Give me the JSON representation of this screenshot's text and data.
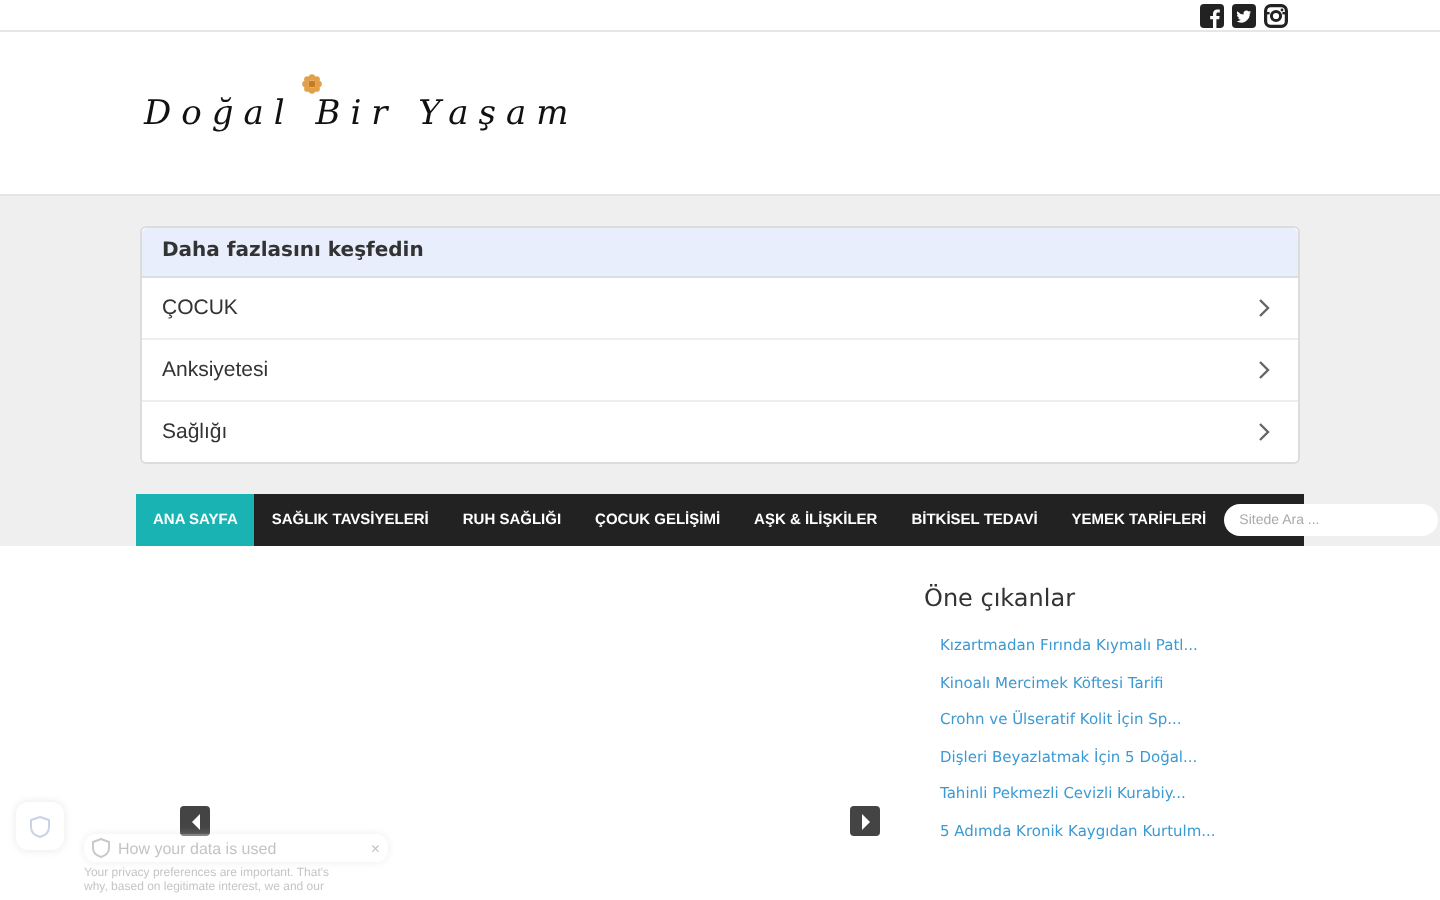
{
  "site": {
    "logo": "Doğal Bir Yaşam"
  },
  "explore": {
    "title": "Daha fazlasını keşfedin",
    "items": [
      "ÇOCUK",
      "Anksiyetesi",
      "Sağlığı"
    ]
  },
  "nav": {
    "items": [
      {
        "label": "ANA SAYFA",
        "selected": true
      },
      {
        "label": "SAĞLIK TAVSİYELERİ",
        "selected": false
      },
      {
        "label": "RUH SAĞLIĞI",
        "selected": false
      },
      {
        "label": "ÇOCUK GELİŞİMİ",
        "selected": false
      },
      {
        "label": "AŞK & İLİŞKİLER",
        "selected": false
      },
      {
        "label": "BİTKİSEL TEDAVİ",
        "selected": false
      },
      {
        "label": "YEMEK TARİFLERİ",
        "selected": false
      }
    ],
    "search": {
      "placeholder": "Sitede Ara ..."
    }
  },
  "featured": {
    "title": "Öne çıkanlar",
    "items": [
      "Kızartmadan Fırında Kıymalı Patl...",
      "Kinoalı Mercimek Köftesi Tarifi",
      "Crohn ve Ülseratif Kolit İçin Sp...",
      "Dişleri Beyazlatmak İçin 5 Doğal...",
      "Tahinli Pekmezli Cevizli Kurabiy...",
      "5 Adımda Kronik Kaygıdan Kurtulm..."
    ]
  },
  "privacy": {
    "title": "How your data is used",
    "close": "×",
    "text": "Your privacy preferences are important. That's why, based on legitimate interest, we and our"
  }
}
